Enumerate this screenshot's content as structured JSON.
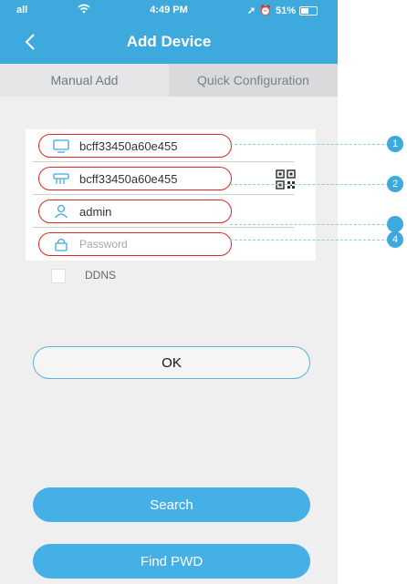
{
  "status_bar": {
    "signal": "all",
    "time": "4:49 PM",
    "battery": "51%"
  },
  "nav": {
    "title": "Add Device"
  },
  "tabs": [
    {
      "label": "Manual Add"
    },
    {
      "label": "Quick Configuration"
    }
  ],
  "form": {
    "device_id": "bcff33450a60e455",
    "serial": "bcff33450a60e455",
    "username": "admin",
    "password_placeholder": "Password",
    "ddns_label": "DDNS",
    "ok_label": "OK"
  },
  "buttons": {
    "search": "Search",
    "find_pwd": "Find PWD"
  },
  "callouts": [
    "1",
    "2",
    "",
    "4"
  ],
  "colors": {
    "accent": "#3da9dd",
    "highlight": "#e02626",
    "button": "#45b0e6"
  }
}
